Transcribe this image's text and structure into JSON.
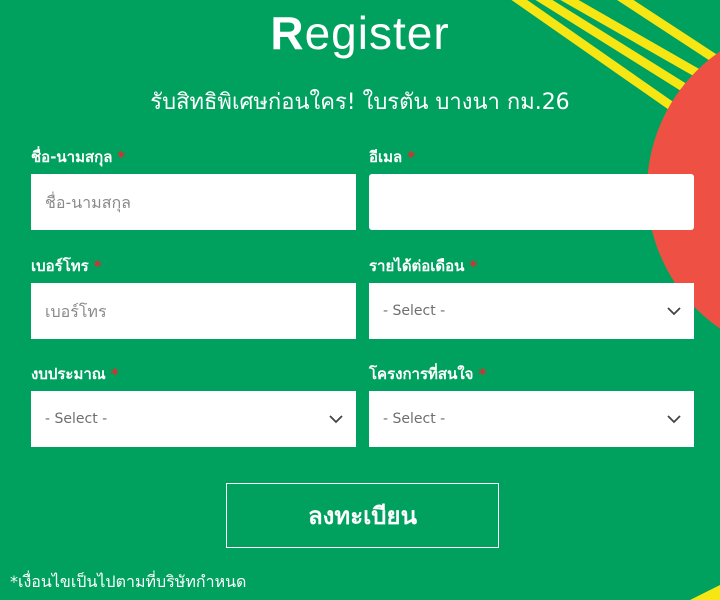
{
  "header": {
    "title_first_letter": "R",
    "title_rest": "egister",
    "subtitle": "รับสิทธิพิเศษก่อนใคร! ใบรตัน บางนา กม.26"
  },
  "form": {
    "required_mark": "*",
    "name": {
      "label": "ชื่อ-นามสกุล",
      "placeholder": "ชื่อ-นามสกุล",
      "value": ""
    },
    "email": {
      "label": "อีเมล",
      "placeholder": "",
      "value": ""
    },
    "phone": {
      "label": "เบอร์โทร",
      "placeholder": "เบอร์โทร",
      "value": ""
    },
    "income": {
      "label": "รายได้ต่อเดือน",
      "selected": "- Select -"
    },
    "budget": {
      "label": "งบประมาณ",
      "selected": "- Select -"
    },
    "project": {
      "label": "โครงการที่สนใจ",
      "selected": "- Select -"
    },
    "submit_label": "ลงทะเบียน"
  },
  "footer": {
    "note": "*เงื่อนไขเป็นไปตามที่บริษัทกำหนด"
  },
  "colors": {
    "background": "#00a15e",
    "accent_circle": "#ef5044",
    "stripe": "#f5e614",
    "required": "#e8272d"
  },
  "icons": {
    "select_arrow": "chevron-down-icon"
  }
}
